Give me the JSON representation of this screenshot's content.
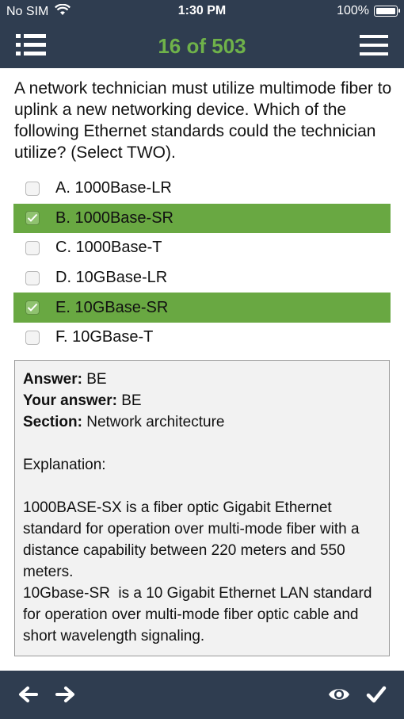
{
  "status": {
    "carrier": "No SIM",
    "time": "1:30 PM",
    "battery": "100%"
  },
  "nav": {
    "title": "16 of 503"
  },
  "question": "A network technician must utilize multimode fiber to uplink a new networking device. Which of the following Ethernet standards could the technician utilize? (Select TWO).",
  "options": [
    {
      "label": "A. 1000Base-LR",
      "selected": false
    },
    {
      "label": "B. 1000Base-SR",
      "selected": true
    },
    {
      "label": "C. 1000Base-T",
      "selected": false
    },
    {
      "label": "D. 10GBase-LR",
      "selected": false
    },
    {
      "label": "E. 10GBase-SR",
      "selected": true
    },
    {
      "label": "F. 10GBase-T",
      "selected": false
    }
  ],
  "answer": {
    "answer_label": "Answer:",
    "answer_value": "BE",
    "your_answer_label": "Your answer:",
    "your_answer_value": "BE",
    "section_label": "Section:",
    "section_value": "Network architecture",
    "explanation_label": "Explanation:",
    "explanation_p1": "1000BASE-SX is a fiber optic Gigabit Ethernet standard for operation over multi-mode fiber with a distance capability between 220 meters and 550 meters.",
    "explanation_p2": "10Gbase-SR  is a 10 Gigabit Ethernet LAN standard for operation over multi-mode fiber optic cable and short wavelength signaling."
  },
  "colors": {
    "bar": "#2f3d50",
    "title_green": "#6fb24a",
    "selected_green": "#69a842"
  },
  "icons": [
    "wifi-icon",
    "battery-icon",
    "list-icon",
    "menu-icon",
    "checkmark-icon",
    "arrow-left-icon",
    "arrow-right-icon",
    "eye-icon",
    "check-icon"
  ]
}
